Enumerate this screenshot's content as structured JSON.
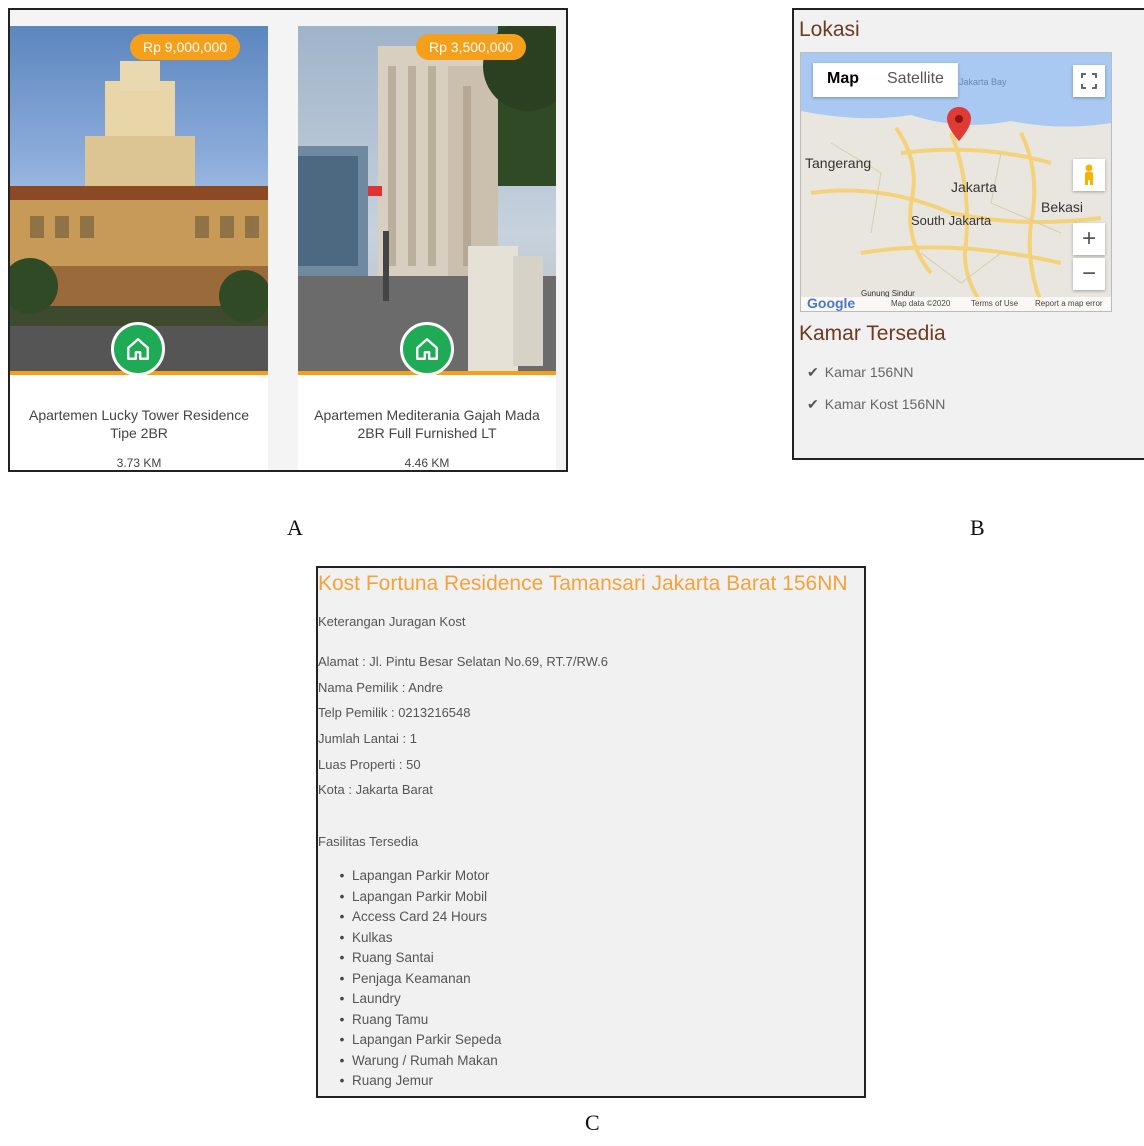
{
  "captions": {
    "a": "A",
    "b": "B",
    "c": "C"
  },
  "panel_a": {
    "cards": [
      {
        "price": "Rp 9,000,000",
        "title": "Apartemen Lucky Tower Residence Tipe 2BR",
        "distance": "3.73 KM",
        "icon": "home-icon"
      },
      {
        "price": "Rp 3,500,000",
        "title": "Apartemen Mediterania Gajah Mada 2BR Full Furnished LT",
        "distance": "4.46 KM",
        "icon": "home-icon"
      }
    ]
  },
  "panel_b": {
    "section_title": "Lokasi",
    "map": {
      "tabs": [
        "Map",
        "Satellite"
      ],
      "active_tab": "Map",
      "labels": {
        "bay": "Jakarta Bay",
        "tangerang": "Tangerang",
        "jakarta": "Jakarta",
        "south_jakarta": "South Jakarta",
        "bekasi": "Bekasi",
        "gunung": "Gunung Sindur"
      },
      "footer": {
        "logo": "Google",
        "data": "Map data ©2020",
        "terms": "Terms of Use",
        "report": "Report a map error"
      },
      "zoom_in": "+",
      "zoom_out": "−"
    },
    "rooms_title": "Kamar Tersedia",
    "rooms": [
      "Kamar 156NN",
      "Kamar Kost 156NN"
    ]
  },
  "panel_c": {
    "title": "Kost Fortuna Residence Tamansari Jakarta Barat 156NN",
    "owner_section": "Keterangan Juragan Kost",
    "details": [
      "Alamat : Jl. Pintu Besar Selatan No.69, RT.7/RW.6",
      "Nama Pemilik : Andre",
      "Telp Pemilik : 0213216548",
      "Jumlah Lantai : 1",
      "Luas Properti : 50",
      "Kota : Jakarta Barat"
    ],
    "facilities_title": "Fasilitas Tersedia",
    "facilities": [
      "Lapangan Parkir Motor",
      "Lapangan Parkir Mobil",
      "Access Card 24 Hours",
      "Kulkas",
      "Ruang Santai",
      "Penjaga Keamanan",
      "Laundry",
      "Ruang Tamu",
      "Lapangan Parkir Sepeda",
      "Warung / Rumah Makan",
      "Ruang Jemur"
    ]
  },
  "colors": {
    "accent_orange": "#f5a01a",
    "green": "#1faa55",
    "brown_heading": "#6e3a20",
    "title_orange": "#f6a23a"
  }
}
